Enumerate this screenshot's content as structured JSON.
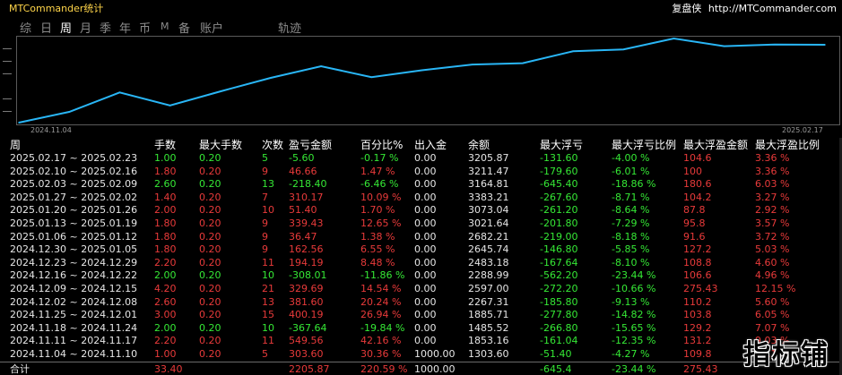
{
  "app": {
    "title": "MTCommander统计",
    "brand_name": "复盘侠",
    "brand_url": "http://MTCommander.com"
  },
  "tabs": [
    {
      "label": "综",
      "active": false
    },
    {
      "label": "日",
      "active": false
    },
    {
      "label": "周",
      "active": true
    },
    {
      "label": "月",
      "active": false
    },
    {
      "label": "季",
      "active": false
    },
    {
      "label": "年",
      "active": false
    },
    {
      "label": "币",
      "active": false
    },
    {
      "label": "M",
      "active": false
    },
    {
      "label": "备",
      "active": false
    },
    {
      "label": "账户",
      "active": false
    },
    {
      "label": "轨迹",
      "active": false
    }
  ],
  "colors": {
    "line": "#29b6f6",
    "positive": "#35e835",
    "negative": "#e83a3a",
    "title": "#ffd54a"
  },
  "chart_data": {
    "type": "line",
    "x_start_label": "2024.11.04",
    "x_end_label": "2025.02.17",
    "x": [
      "2024.11.04",
      "2024.11.11",
      "2024.11.18",
      "2024.11.25",
      "2024.12.02",
      "2024.12.09",
      "2024.12.16",
      "2024.12.23",
      "2024.12.30",
      "2025.01.06",
      "2025.01.13",
      "2025.01.20",
      "2025.01.27",
      "2025.02.03",
      "2025.02.10",
      "2025.02.17"
    ],
    "values": [
      1000.0,
      1303.6,
      1853.16,
      1485.52,
      1885.71,
      2267.31,
      2597.0,
      2288.99,
      2483.18,
      2645.74,
      2682.21,
      3021.64,
      3073.04,
      3383.21,
      3164.81,
      3211.47,
      3205.87
    ],
    "grid": false
  },
  "table": {
    "headers": [
      "周",
      "手数",
      "最大手数",
      "次数",
      "盈亏金额",
      "百分比%",
      "出入金",
      "余额",
      "最大浮亏",
      "最大浮亏比例",
      "最大浮盈金额",
      "最大浮盈比例"
    ],
    "rows": [
      [
        "2025.02.17 ~ 2025.02.23",
        "1.00",
        "0.20",
        "5",
        "-5.60",
        "-0.17 %",
        "0.00",
        "3205.87",
        "-131.60",
        "-4.00 %",
        "104.6",
        "3.36 %"
      ],
      [
        "2025.02.10 ~ 2025.02.16",
        "1.80",
        "0.20",
        "9",
        "46.66",
        "1.47 %",
        "0.00",
        "3211.47",
        "-179.60",
        "-6.01 %",
        "100",
        "3.36 %"
      ],
      [
        "2025.02.03 ~ 2025.02.09",
        "2.60",
        "0.20",
        "13",
        "-218.40",
        "-6.46 %",
        "0.00",
        "3164.81",
        "-645.40",
        "-18.86 %",
        "180.6",
        "6.03 %"
      ],
      [
        "2025.01.27 ~ 2025.02.02",
        "1.40",
        "0.20",
        "7",
        "310.17",
        "10.09 %",
        "0.00",
        "3383.21",
        "-267.60",
        "-8.71 %",
        "104.2",
        "3.27 %"
      ],
      [
        "2025.01.20 ~ 2025.01.26",
        "2.00",
        "0.20",
        "10",
        "51.40",
        "1.70 %",
        "0.00",
        "3073.04",
        "-261.20",
        "-8.64 %",
        "87.8",
        "2.92 %"
      ],
      [
        "2025.01.13 ~ 2025.01.19",
        "1.80",
        "0.20",
        "9",
        "339.43",
        "12.65 %",
        "0.00",
        "3021.64",
        "-201.80",
        "-7.29 %",
        "95.8",
        "3.57 %"
      ],
      [
        "2025.01.06 ~ 2025.01.12",
        "1.80",
        "0.20",
        "9",
        "36.47",
        "1.38 %",
        "0.00",
        "2682.21",
        "-219.00",
        "-8.18 %",
        "91.6",
        "3.72 %"
      ],
      [
        "2024.12.30 ~ 2025.01.05",
        "1.80",
        "0.20",
        "9",
        "162.56",
        "6.55 %",
        "0.00",
        "2645.74",
        "-146.80",
        "-5.85 %",
        "127.2",
        "5.03 %"
      ],
      [
        "2024.12.23 ~ 2024.12.29",
        "2.20",
        "0.20",
        "11",
        "194.19",
        "8.48 %",
        "0.00",
        "2483.18",
        "-167.64",
        "-8.10 %",
        "108.8",
        "4.60 %"
      ],
      [
        "2024.12.16 ~ 2024.12.22",
        "2.00",
        "0.20",
        "10",
        "-308.01",
        "-11.86 %",
        "0.00",
        "2288.99",
        "-562.20",
        "-23.44 %",
        "106.6",
        "4.96 %"
      ],
      [
        "2024.12.09 ~ 2024.12.15",
        "4.20",
        "0.20",
        "21",
        "329.69",
        "14.54 %",
        "0.00",
        "2597.00",
        "-272.20",
        "-10.66 %",
        "275.43",
        "12.15 %"
      ],
      [
        "2024.12.02 ~ 2024.12.08",
        "2.60",
        "0.20",
        "13",
        "381.60",
        "20.24 %",
        "0.00",
        "2267.31",
        "-185.80",
        "-9.13 %",
        "110.2",
        "5.60 %"
      ],
      [
        "2024.11.25 ~ 2024.12.01",
        "3.00",
        "0.20",
        "15",
        "400.19",
        "26.94 %",
        "0.00",
        "1885.71",
        "-277.80",
        "-14.82 %",
        "103.8",
        "6.05 %"
      ],
      [
        "2024.11.18 ~ 2024.11.24",
        "2.00",
        "0.20",
        "10",
        "-367.64",
        "-19.84 %",
        "0.00",
        "1485.52",
        "-266.80",
        "-15.65 %",
        "129.2",
        "7.07 %"
      ],
      [
        "2024.11.11 ~ 2024.11.17",
        "2.20",
        "0.20",
        "11",
        "549.56",
        "42.16 %",
        "0.00",
        "1853.16",
        "-161.04",
        "-12.35 %",
        "131.2",
        "9.03 %"
      ],
      [
        "2024.11.04 ~ 2024.11.10",
        "1.00",
        "0.20",
        "5",
        "303.60",
        "30.36 %",
        "1000.00",
        "1303.60",
        "-51.40",
        "-4.27 %",
        "109.8",
        "10.19 %"
      ]
    ],
    "total": [
      "合计",
      "33.40",
      "",
      "",
      "2205.87",
      "220.59 %",
      "1000.00",
      "",
      "-645.4",
      "-23.44 %",
      "275.43",
      ""
    ]
  },
  "watermark": "指标铺"
}
